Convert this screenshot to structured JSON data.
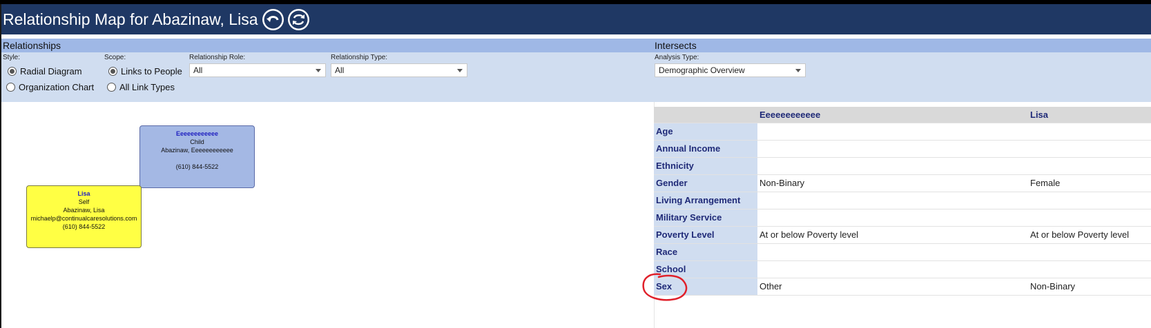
{
  "header": {
    "title": "Relationship Map for Abazinaw, Lisa",
    "icons": [
      "undo-icon",
      "refresh-icon"
    ]
  },
  "relationships": {
    "heading": "Relationships",
    "style_label": "Style:",
    "style_options": [
      "Radial Diagram",
      "Organization Chart"
    ],
    "style_selected": "Radial Diagram",
    "scope_label": "Scope:",
    "scope_options": [
      "Links to People",
      "All Link Types"
    ],
    "scope_selected": "Links to People",
    "role_label": "Relationship Role:",
    "role_value": "All",
    "type_label": "Relationship Type:",
    "type_value": "All"
  },
  "intersects": {
    "heading": "Intersects",
    "analysis_label": "Analysis Type:",
    "analysis_value": "Demographic Overview",
    "columns": [
      "",
      "Eeeeeeeeeeee",
      "Lisa"
    ],
    "rows": [
      {
        "label": "Age",
        "a": "",
        "b": ""
      },
      {
        "label": "Annual Income",
        "a": "",
        "b": ""
      },
      {
        "label": "Ethnicity",
        "a": "",
        "b": ""
      },
      {
        "label": "Gender",
        "a": "Non-Binary",
        "b": "Female"
      },
      {
        "label": "Living Arrangement",
        "a": "",
        "b": ""
      },
      {
        "label": "Military Service",
        "a": "",
        "b": ""
      },
      {
        "label": "Poverty Level",
        "a": "At or below Poverty level",
        "b": "At or below Poverty level"
      },
      {
        "label": "Race",
        "a": "",
        "b": ""
      },
      {
        "label": "School",
        "a": "",
        "b": ""
      },
      {
        "label": "Sex",
        "a": "Other",
        "b": "Non-Binary"
      }
    ]
  },
  "nodes": {
    "child": {
      "name": "Eeeeeeeeeeee",
      "role": "Child",
      "full": "Abazinaw, Eeeeeeeeeeee",
      "phone": "(610) 844-5522",
      "color": "#a4b8e4"
    },
    "self": {
      "name": "Lisa",
      "role": "Self",
      "full": "Abazinaw, Lisa",
      "email": "michaelp@continualcaresolutions.com",
      "phone": "(610) 844-5522",
      "color": "#ffff44"
    }
  },
  "colors": {
    "titlebar": "#1f3864",
    "panel_head": "#9fb8e6",
    "controls_bg": "#d0ddf0",
    "annotation": "#e0202a"
  }
}
